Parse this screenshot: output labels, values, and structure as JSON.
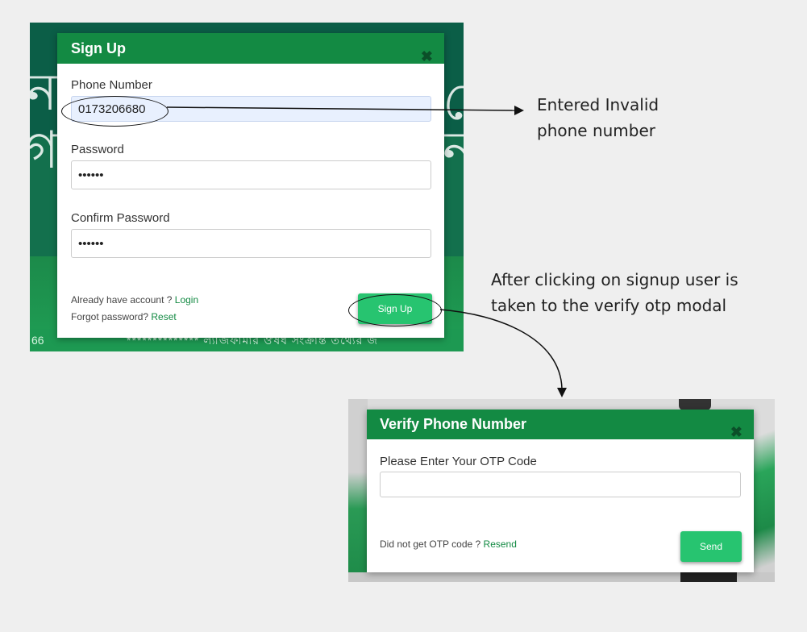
{
  "signup": {
    "background_ticker_number": "66",
    "background_ticker_text": "************** ল্যাজফার্মার ঔষধ সংক্রান্ত তথ্যের জ",
    "title": "Sign Up",
    "close_icon": "✖",
    "phone_label": "Phone Number",
    "phone_value": "0173206680",
    "password_label": "Password",
    "password_value": "••••••",
    "confirm_label": "Confirm Password",
    "confirm_value": "••••••",
    "already_text": "Already have account ?",
    "login_link": "Login",
    "forgot_text": "Forgot password?",
    "reset_link": "Reset",
    "submit_label": "Sign Up"
  },
  "verify": {
    "title": "Verify Phone Number",
    "close_icon": "✖",
    "otp_label": "Please Enter Your OTP Code",
    "otp_value": "",
    "resend_text": "Did not get OTP code ?",
    "resend_link": "Resend",
    "send_label": "Send"
  },
  "annotations": {
    "invalid_phone_line1": "Entered Invalid",
    "invalid_phone_line2": "phone number",
    "signup_flow_line1": "After clicking on signup user is",
    "signup_flow_line2": "taken to the verify otp modal"
  },
  "colors": {
    "header_green": "#138a43",
    "button_green": "#27c470",
    "link_green": "#138a43",
    "background": "#efefef"
  },
  "icons": {
    "close": "close-icon",
    "arrow": "arrow-right-icon"
  }
}
